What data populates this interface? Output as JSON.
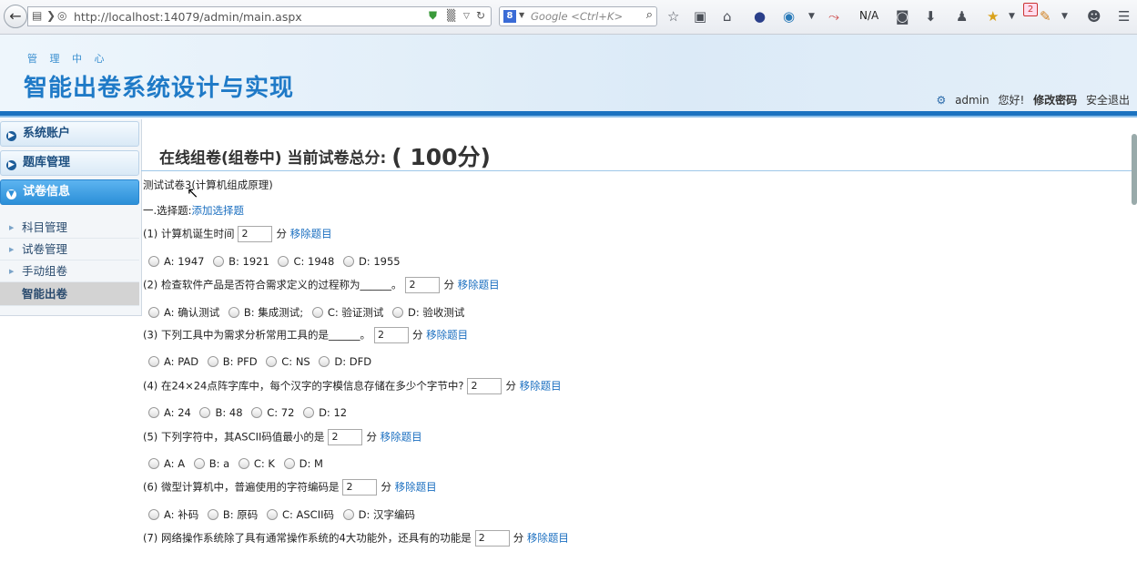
{
  "browser": {
    "url": "http://localhost:14079/admin/main.aspx",
    "search_placeholder": "Google <Ctrl+K>",
    "search_engine": "8",
    "na_label": "N/A",
    "notification_count": "2"
  },
  "header": {
    "subtitle": "管 理 中 心",
    "title": "智能出卷系统设计与实现",
    "username": "admin",
    "greeting": "您好!",
    "change_password": "修改密码",
    "logout": "安全退出"
  },
  "sidebar": {
    "sections": [
      {
        "label": "系统账户"
      },
      {
        "label": "题库管理"
      },
      {
        "label": "试卷信息"
      }
    ],
    "items": [
      {
        "label": "科目管理"
      },
      {
        "label": "试卷管理"
      },
      {
        "label": "手动组卷"
      },
      {
        "label": "智能出卷"
      }
    ]
  },
  "main": {
    "title": "在线组卷(组卷中) 当前试卷总分:",
    "total_score": "( 100分)",
    "paper_name": "测试试卷3(计算机组成原理)",
    "section_label": "一.选择题:",
    "add_link": "添加选择题",
    "score_unit": "分",
    "remove_link": "移除题目",
    "questions": [
      {
        "text": "(1) 计算机诞生时间",
        "score": "2",
        "options": [
          "A: 1947",
          "B: 1921",
          "C: 1948",
          "D: 1955"
        ]
      },
      {
        "text": "(2) 检查软件产品是否符合需求定义的过程称为______。",
        "score": "2",
        "options": [
          "A: 确认测试",
          "B: 集成测试;",
          "C: 验证测试",
          "D: 验收测试"
        ]
      },
      {
        "text": "(3) 下列工具中为需求分析常用工具的是______。",
        "score": "2",
        "options": [
          "A: PAD",
          "B: PFD",
          "C: NS",
          "D: DFD"
        ]
      },
      {
        "text": "(4) 在24×24点阵字库中，每个汉字的字模信息存储在多少个字节中?",
        "score": "2",
        "options": [
          "A: 24",
          "B: 48",
          "C: 72",
          "D: 12"
        ]
      },
      {
        "text": "(5) 下列字符中，其ASCII码值最小的是",
        "score": "2",
        "options": [
          "A: A",
          "B: a",
          "C: K",
          "D: M"
        ]
      },
      {
        "text": "(6) 微型计算机中，普遍使用的字符编码是",
        "score": "2",
        "options": [
          "A: 补码",
          "B: 原码",
          "C: ASCII码",
          "D: 汉字编码"
        ]
      },
      {
        "text": "(7) 网络操作系统除了具有通常操作系统的4大功能外，还具有的功能是",
        "score": "2",
        "options": []
      }
    ]
  }
}
